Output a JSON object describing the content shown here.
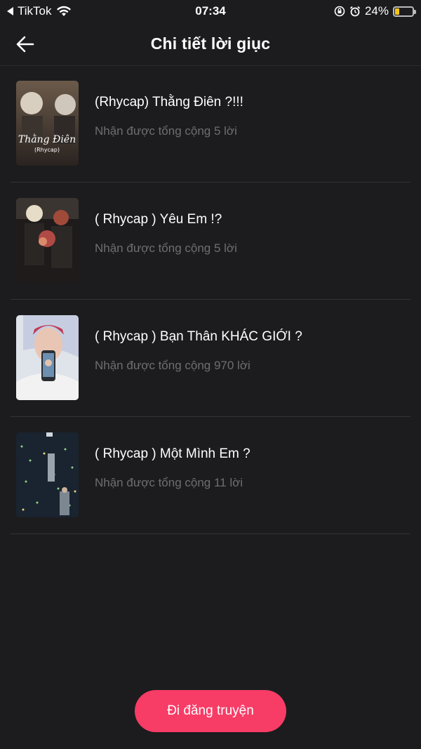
{
  "status_bar": {
    "app_name": "TikTok",
    "time": "07:34",
    "battery": "24%",
    "battery_level": 0.24,
    "battery_color": "#f5c518"
  },
  "header": {
    "title": "Chi tiết lời giục",
    "back_icon": "arrow-left-icon"
  },
  "items": [
    {
      "title": "(Rhycap) Thằng Điên ?!!!",
      "subtitle": "Nhận được tổng cộng 5 lời",
      "cover_text": "Thằng Điên",
      "cover_subtext": "(Rhycap)"
    },
    {
      "title": "( Rhycap ) Yêu Em !?",
      "subtitle": "Nhận được tổng cộng 5 lời"
    },
    {
      "title": "( Rhycap ) Bạn Thân KHÁC GIỚI ?",
      "subtitle": "Nhận được tổng cộng 970 lời"
    },
    {
      "title": "( Rhycap ) Một Mình Em ?",
      "subtitle": "Nhận được tổng cộng 11 lời"
    }
  ],
  "post_button": {
    "label": "Đi đăng truyện",
    "color": "#f73c66"
  }
}
